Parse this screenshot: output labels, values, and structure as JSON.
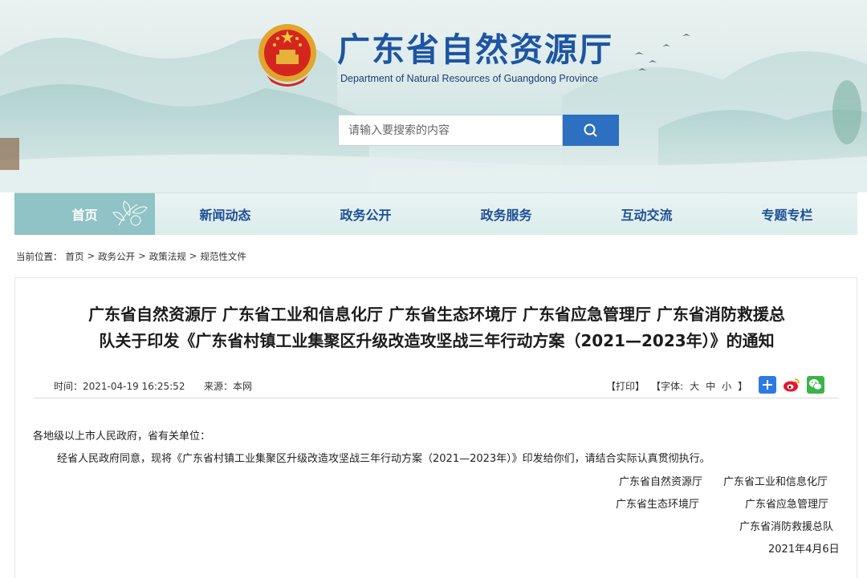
{
  "header": {
    "site_title": "广东省自然资源厅",
    "site_subtitle": "Department of Natural Resources of Guangdong Province",
    "search_placeholder": "请输入要搜索的内容"
  },
  "nav": {
    "items": [
      {
        "label": "首页",
        "active": true
      },
      {
        "label": "新闻动态",
        "active": false
      },
      {
        "label": "政务公开",
        "active": false
      },
      {
        "label": "政务服务",
        "active": false
      },
      {
        "label": "互动交流",
        "active": false
      },
      {
        "label": "专题专栏",
        "active": false
      }
    ]
  },
  "breadcrumb": {
    "prefix": "当前位置：",
    "items": [
      "首页",
      "政务公开",
      "政策法规",
      "规范性文件"
    ],
    "separator": ">"
  },
  "article": {
    "title_line1": "广东省自然资源厅 广东省工业和信息化厅 广东省生态环境厅 广东省应急管理厅 广东省消防救援总",
    "title_line2": "队关于印发《广东省村镇工业集聚区升级改造攻坚战三年行动方案（2021—2023年）》的通知",
    "time": "时间：2021-04-19 16:25:52",
    "source": "来源：本网",
    "print": "【打印】",
    "font_size_label": "【字体:",
    "font_large": "大",
    "font_medium": "中",
    "font_small": "小",
    "font_close": "】",
    "salutation": "各地级以上市人民政府，省有关单位：",
    "paragraph": "经省人民政府同意，现将《广东省村镇工业集聚区升级改造攻坚战三年行动方案（2021—2023年）》印发给你们，请结合实际认真贯彻执行。",
    "signatories": [
      "广东省自然资源厅",
      "广东省工业和信息化厅",
      "广东省生态环境厅",
      "广东省应急管理厅",
      "广东省消防救援总队"
    ],
    "date": "2021年4月6日"
  },
  "share_icons": [
    "plus-share-icon",
    "weibo-icon",
    "wechat-icon"
  ],
  "colors": {
    "brand_blue": "#1d55a3",
    "search_button": "#2d6fc0",
    "nav_active": "#8fc3c6"
  }
}
